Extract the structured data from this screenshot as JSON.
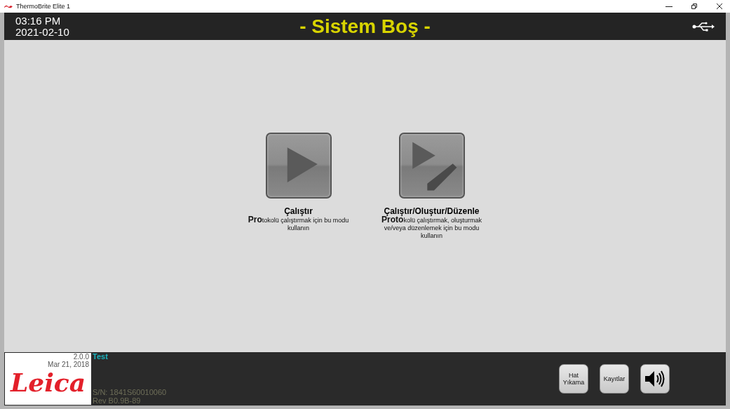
{
  "window": {
    "title": "ThermoBrite Elite 1"
  },
  "header": {
    "time": "03:16 PM",
    "date": "2021-02-10",
    "status": "- Sistem Boş -"
  },
  "modes": [
    {
      "kind": "run",
      "title": "Çalıştır",
      "description": "**Pro**tokolü çalıştırmak için bu modu kullanın"
    },
    {
      "kind": "edit",
      "title": "Çalıştır/Oluştur/Düzenle",
      "description": "**Proto**kolü çalıştırmak, oluşturmak ve/veya düzenlemek için bu modu kullanın"
    }
  ],
  "footer": {
    "version": "2.0.0",
    "build_date": "Mar 21, 2018",
    "logo": "Leica",
    "user": "Test",
    "serial": "S/N: 1841S60010060",
    "revision": "Rev B0.9B-89",
    "buttons": [
      {
        "kind": "text",
        "label": "Hat Yıkama"
      },
      {
        "kind": "text",
        "label": "Kayıtlar"
      },
      {
        "kind": "sound"
      }
    ]
  }
}
